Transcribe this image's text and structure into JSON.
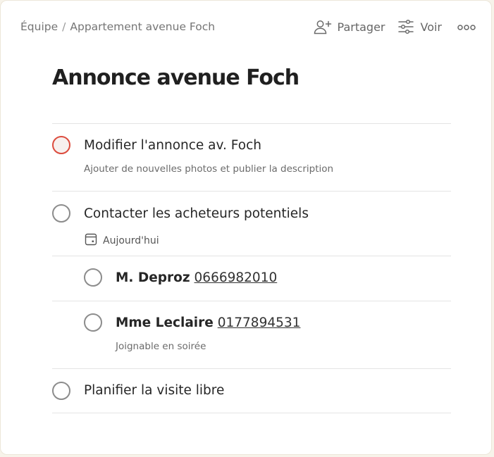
{
  "breadcrumb": {
    "team": "Équipe",
    "separator": "/",
    "project": "Appartement avenue Foch"
  },
  "toolbar": {
    "share_label": "Partager",
    "view_label": "Voir",
    "share_icon": "add-person-icon",
    "view_icon": "sliders-icon",
    "more_icon": "more-dots-icon"
  },
  "page": {
    "title": "Annonce avenue Foch"
  },
  "colors": {
    "priority": "#dc4c3e",
    "checkbox": "#8c8c8c"
  },
  "tasks": [
    {
      "title": "Modifier l'annonce av. Foch",
      "description": "Ajouter de nouvelles photos et publier la description",
      "priority": true
    },
    {
      "title": "Contacter les acheteurs potentiels",
      "due": "Aujourd'hui",
      "subtasks": [
        {
          "name": "M. Deproz",
          "phone": "0666982010"
        },
        {
          "name": "Mme Leclaire",
          "phone": "0177894531",
          "description": "Joignable en soirée"
        }
      ]
    },
    {
      "title": "Planifier la visite libre"
    }
  ]
}
